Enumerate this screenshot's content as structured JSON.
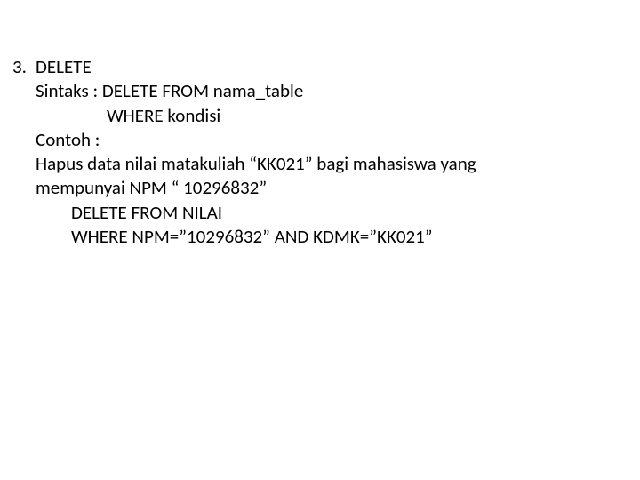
{
  "item": {
    "number": "3.",
    "title": "DELETE",
    "lines": {
      "syntax1": "Sintaks : DELETE FROM nama_table",
      "syntax2": "WHERE kondisi",
      "example_label": "Contoh :",
      "example_desc1": "Hapus data nilai matakuliah “KK021” bagi mahasiswa yang",
      "example_desc2": "mempunyai NPM “ 10296832”",
      "sql1": "DELETE FROM NILAI",
      "sql2": "WHERE  NPM=”10296832” AND KDMK=”KK021”"
    }
  }
}
